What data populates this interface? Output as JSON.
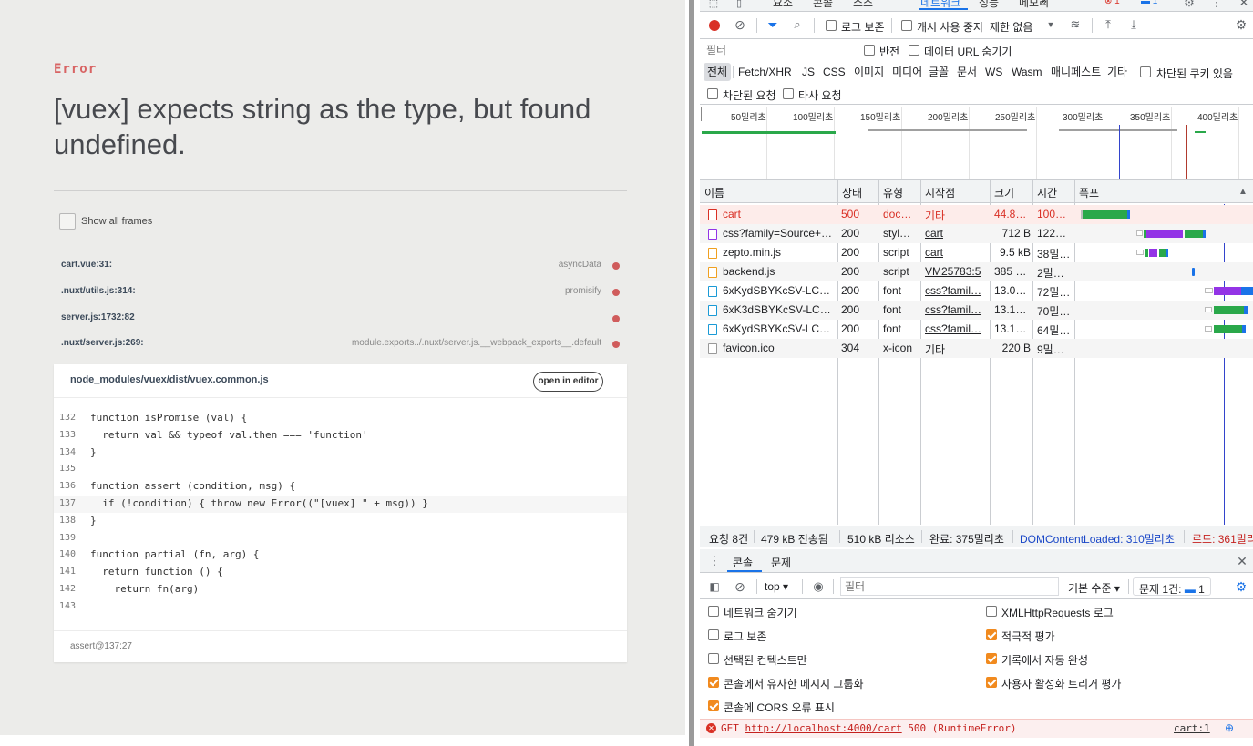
{
  "error_page": {
    "label": "Error",
    "message": "[vuex] expects string as the type, but found undefined.",
    "show_all_frames": "Show all frames",
    "frames": [
      {
        "file": "cart.vue:31:",
        "fn": "asyncData"
      },
      {
        "file": ".nuxt/utils.js:314:",
        "fn": "promisify"
      },
      {
        "file": "server.js:1732:82",
        "fn": ""
      },
      {
        "file": ".nuxt/server.js:269:",
        "fn": "module.exports../.nuxt/server.js.__webpack_exports__.default"
      }
    ],
    "code_file": "node_modules/vuex/dist/vuex.common.js",
    "open_in_editor": "open in editor",
    "code_lines": [
      {
        "num": "132",
        "text": "function isPromise (val) {"
      },
      {
        "num": "133",
        "text": "  return val && typeof val.then === 'function'"
      },
      {
        "num": "134",
        "text": "}"
      },
      {
        "num": "135",
        "text": ""
      },
      {
        "num": "136",
        "text": "function assert (condition, msg) {"
      },
      {
        "num": "137",
        "text": "  if (!condition) { throw new Error((\"[vuex] \" + msg)) }"
      },
      {
        "num": "138",
        "text": "}"
      },
      {
        "num": "139",
        "text": ""
      },
      {
        "num": "140",
        "text": "function partial (fn, arg) {"
      },
      {
        "num": "141",
        "text": "  return function () {"
      },
      {
        "num": "142",
        "text": "    return fn(arg)"
      },
      {
        "num": "143",
        "text": ""
      }
    ],
    "footer": "assert@137:27"
  },
  "devtools": {
    "top_tabs": [
      "요소",
      "콘솔",
      "소스",
      "네트워크",
      "성능",
      "메모리",
      "»"
    ],
    "error_count": "1",
    "message_count": "1",
    "toolbar": {
      "preserve_log": "로그 보존",
      "disable_cache": "캐시 사용 중지",
      "throttle": "제한 없음"
    },
    "filter": {
      "placeholder": "필터",
      "invert": "반전",
      "hide_data_urls": "데이터 URL 숨기기",
      "types": [
        "전체",
        "Fetch/XHR",
        "JS",
        "CSS",
        "이미지",
        "미디어",
        "글꼴",
        "문서",
        "WS",
        "Wasm",
        "매니페스트",
        "기타"
      ],
      "blocked_cookies": "차단된 쿠키 있음",
      "blocked_requests": "차단된 요청",
      "third_party": "타사 요청"
    },
    "timeline_ticks": [
      "50밀리초",
      "100밀리초",
      "150밀리초",
      "200밀리초",
      "250밀리초",
      "300밀리초",
      "350밀리초",
      "400밀리초"
    ],
    "columns": [
      "이름",
      "상태",
      "유형",
      "시작점",
      "크기",
      "시간",
      "폭포"
    ],
    "requests": [
      {
        "name": "cart",
        "status": "500",
        "type": "doc…",
        "initiator": "기타",
        "size": "44.8…",
        "time": "100…",
        "error": true
      },
      {
        "name": "css?family=Source+…",
        "status": "200",
        "type": "styl…",
        "initiator": "cart",
        "size": "712 B",
        "time": "122…"
      },
      {
        "name": "zepto.min.js",
        "status": "200",
        "type": "script",
        "initiator": "cart",
        "size": "9.5 kB",
        "time": "38밀…"
      },
      {
        "name": "backend.js",
        "status": "200",
        "type": "script",
        "initiator": "VM25783:5",
        "size": "385 …",
        "time": "2밀…"
      },
      {
        "name": "6xKydSBYKcSV-LC…",
        "status": "200",
        "type": "font",
        "initiator": "css?famil…",
        "size": "13.0…",
        "time": "72밀…"
      },
      {
        "name": "6xK3dSBYKcSV-LC…",
        "status": "200",
        "type": "font",
        "initiator": "css?famil…",
        "size": "13.1…",
        "time": "70밀…"
      },
      {
        "name": "6xKydSBYKcSV-LC…",
        "status": "200",
        "type": "font",
        "initiator": "css?famil…",
        "size": "13.1…",
        "time": "64밀…"
      },
      {
        "name": "favicon.ico",
        "status": "304",
        "type": "x-icon",
        "initiator": "기타",
        "size": "220 B",
        "time": "9밀…"
      }
    ],
    "status": {
      "requests": "요청 8건",
      "transferred": "479 kB 전송됨",
      "resources": "510 kB 리소스",
      "finish": "완료: 375밀리초",
      "dcl": "DOMContentLoaded: 310밀리초",
      "load": "로드: 361밀리"
    },
    "drawer": {
      "tabs": [
        "콘솔",
        "문제"
      ],
      "context": "top ▾",
      "filter_placeholder": "필터",
      "level": "기본 수준 ▾",
      "issues": "문제 1건:",
      "issues_count": "1",
      "settings_left": [
        "네트워크 숨기기",
        "로그 보존",
        "선택된 컨텍스트만",
        "콘솔에서 유사한 메시지 그룹화",
        "콘솔에 CORS 오류 표시"
      ],
      "settings_left_checked": [
        false,
        false,
        false,
        true,
        true
      ],
      "settings_right": [
        "XMLHttpRequests 로그",
        "적극적 평가",
        "기록에서 자동 완성",
        "사용자 활성화 트리거 평가"
      ],
      "settings_right_checked": [
        false,
        true,
        true,
        true
      ],
      "error_line": {
        "method": "GET",
        "url": "http://localhost:4000/cart",
        "rest": "500 (RuntimeError)",
        "source": "cart:1"
      }
    }
  }
}
